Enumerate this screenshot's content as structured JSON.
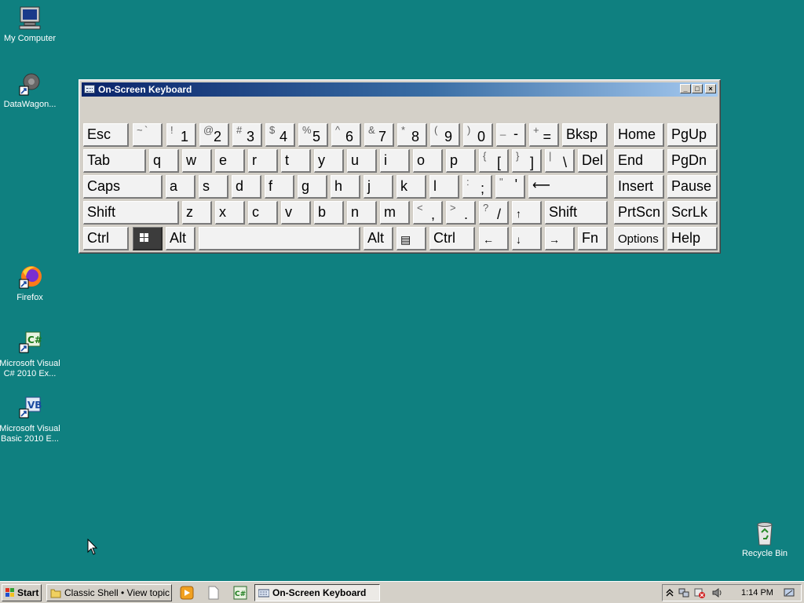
{
  "desktop": {
    "icons": [
      {
        "label": "My Computer",
        "icon": "computer-icon"
      },
      {
        "label": "DataWagon...",
        "icon": "datawagon-icon"
      },
      {
        "label": "Firefox",
        "icon": "firefox-icon"
      },
      {
        "label": "Microsoft Visual C# 2010 Ex...",
        "icon": "visual-csharp-icon"
      },
      {
        "label": "Microsoft Visual Basic 2010 E...",
        "icon": "visual-basic-icon"
      },
      {
        "label": "Recycle Bin",
        "icon": "recycle-bin-icon"
      }
    ]
  },
  "osk": {
    "title": "On-Screen Keyboard",
    "controls": {
      "minimize": "_",
      "maximize": "□",
      "close": "×"
    },
    "keys": {
      "esc": "Esc",
      "tilde_s": "~",
      "tilde_b": "`",
      "d1_s": "!",
      "d1_b": "1",
      "d2_s": "@",
      "d2_b": "2",
      "d3_s": "#",
      "d3_b": "3",
      "d4_s": "$",
      "d4_b": "4",
      "d5_s": "%",
      "d5_b": "5",
      "d6_s": "^",
      "d6_b": "6",
      "d7_s": "&",
      "d7_b": "7",
      "d8_s": "*",
      "d8_b": "8",
      "d9_s": "(",
      "d9_b": "9",
      "d0_s": ")",
      "d0_b": "0",
      "minus_s": "_",
      "minus_b": "-",
      "eq_s": "+",
      "eq_b": "=",
      "bksp": "Bksp",
      "home": "Home",
      "pgup": "PgUp",
      "tab": "Tab",
      "q": "q",
      "w": "w",
      "e": "e",
      "r": "r",
      "t": "t",
      "y": "y",
      "u": "u",
      "i": "i",
      "o": "o",
      "p": "p",
      "lbr_s": "{",
      "lbr_b": "[",
      "rbr_s": "}",
      "rbr_b": "]",
      "bsl_s": "|",
      "bsl_b": "\\",
      "del": "Del",
      "end": "End",
      "pgdn": "PgDn",
      "caps": "Caps",
      "a": "a",
      "s": "s",
      "d": "d",
      "f": "f",
      "g": "g",
      "h": "h",
      "j": "j",
      "k": "k",
      "l": "l",
      "semi_s": ":",
      "semi_b": ";",
      "quote_s": "\"",
      "quote_b": "'",
      "enter": "⟵",
      "insert": "Insert",
      "pause": "Pause",
      "shift": "Shift",
      "z": "z",
      "x": "x",
      "c": "c",
      "v": "v",
      "b": "b",
      "n": "n",
      "m": "m",
      "comma_s": "<",
      "comma_b": ",",
      "period_s": ">",
      "period_b": ".",
      "slash_s": "?",
      "slash_b": "/",
      "up": "↑",
      "shift_r": "Shift",
      "prtscn": "PrtScn",
      "scrlk": "ScrLk",
      "ctrl": "Ctrl",
      "alt": "Alt",
      "space": "",
      "alt_r": "Alt",
      "menu": "▤",
      "ctrl_r": "Ctrl",
      "left": "←",
      "down": "↓",
      "right": "→",
      "fn": "Fn",
      "options": "Options",
      "help": "Help"
    }
  },
  "taskbar": {
    "start": "Start",
    "buttons": [
      {
        "label": "Classic Shell • View topic ...",
        "icon": "folder-icon"
      },
      {
        "label": "On-Screen Keyboard",
        "icon": "keyboard-icon",
        "active": true
      }
    ],
    "quicklaunch": [
      "media-player-icon",
      "document-icon",
      "visual-csharp-icon"
    ],
    "tray": {
      "icons": [
        "expand-tray-icon",
        "network-icon",
        "security-alert-icon",
        "volume-icon"
      ],
      "clock": "1:14 PM"
    }
  }
}
